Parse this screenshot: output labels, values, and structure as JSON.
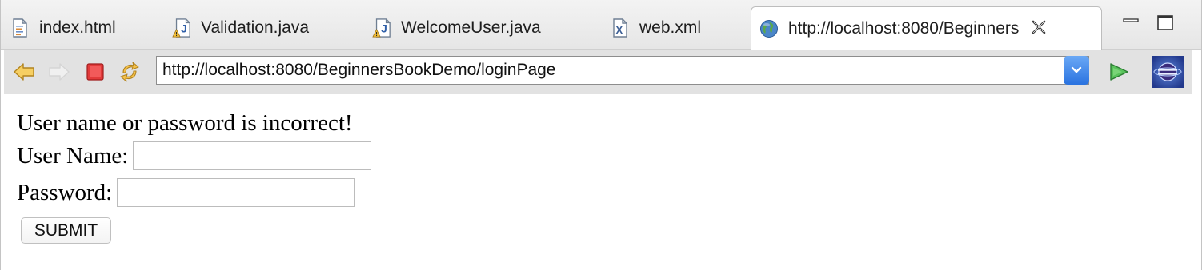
{
  "tabs": [
    {
      "label": "index.html",
      "icon": "html-file-icon"
    },
    {
      "label": "Validation.java",
      "icon": "java-file-warning-icon"
    },
    {
      "label": "WelcomeUser.java",
      "icon": "java-file-warning-icon"
    },
    {
      "label": "web.xml",
      "icon": "xml-file-icon"
    },
    {
      "label": "http://localhost:8080/Beginners",
      "icon": "globe-icon",
      "active": true
    }
  ],
  "browser": {
    "url": "http://localhost:8080/BeginnersBookDemo/loginPage"
  },
  "page": {
    "error_message": "User name or password is incorrect!",
    "username_label": "User Name:",
    "username_value": "",
    "password_label": "Password:",
    "password_value": "",
    "submit_label": "SUBMIT"
  },
  "colors": {
    "toolbar_bg": "#e2e2e2",
    "tabbar_bg": "#ececec",
    "accent_blue": "#2a73e0",
    "stop_red": "#e23a3a",
    "go_green": "#3aa845",
    "nav_arrow_orange": "#f2b33d"
  }
}
